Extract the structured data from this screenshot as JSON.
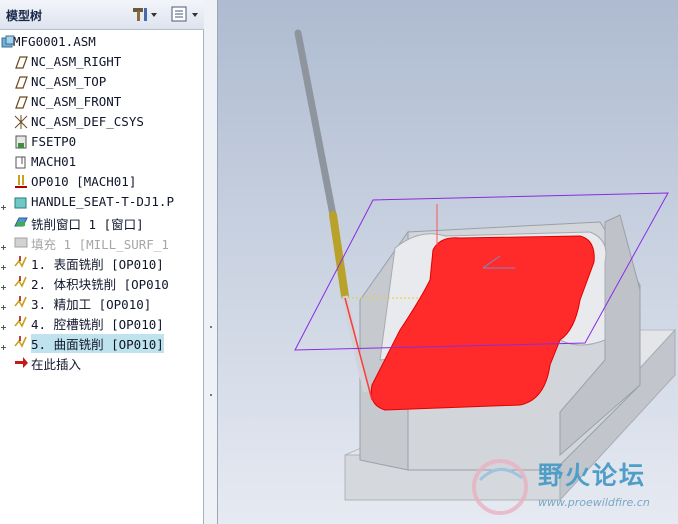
{
  "panel": {
    "title": "模型树",
    "settings_icon": "hammer-settings-icon",
    "show_icon": "list-show-icon"
  },
  "tree": {
    "items": [
      {
        "label": "MFG0001.ASM",
        "icon": "assembly-icon",
        "expander": false,
        "selected": false,
        "dim": false
      },
      {
        "label": "NC_ASM_RIGHT",
        "icon": "datum-plane-icon",
        "expander": false,
        "selected": false,
        "dim": false
      },
      {
        "label": "NC_ASM_TOP",
        "icon": "datum-plane-icon",
        "expander": false,
        "selected": false,
        "dim": false
      },
      {
        "label": "NC_ASM_FRONT",
        "icon": "datum-plane-icon",
        "expander": false,
        "selected": false,
        "dim": false
      },
      {
        "label": "NC_ASM_DEF_CSYS",
        "icon": "csys-icon",
        "expander": false,
        "selected": false,
        "dim": false
      },
      {
        "label": "FSETP0",
        "icon": "fixture-setup-icon",
        "expander": false,
        "selected": false,
        "dim": false
      },
      {
        "label": "MACH01",
        "icon": "machine-icon",
        "expander": false,
        "selected": false,
        "dim": false
      },
      {
        "label": "OP010 [MACH01]",
        "icon": "operation-icon",
        "expander": false,
        "selected": false,
        "dim": false
      },
      {
        "label": "HANDLE_SEAT-T-DJ1.P",
        "icon": "part-icon",
        "expander": true,
        "selected": false,
        "dim": false
      },
      {
        "label": "铣削窗口 1 [窗口]",
        "icon": "mill-window-icon",
        "expander": false,
        "selected": false,
        "dim": false
      },
      {
        "label": "填充 1 [MILL_SURF_1",
        "icon": "fill-icon",
        "expander": true,
        "selected": false,
        "dim": true
      },
      {
        "label": "1. 表面铣削 [OP010]",
        "icon": "toolpath-icon",
        "expander": true,
        "selected": false,
        "dim": false
      },
      {
        "label": "2. 体积块铣削 [OP010",
        "icon": "toolpath-icon",
        "expander": true,
        "selected": false,
        "dim": false
      },
      {
        "label": "3. 精加工 [OP010]",
        "icon": "toolpath-icon",
        "expander": true,
        "selected": false,
        "dim": false
      },
      {
        "label": "4. 腔槽铣削 [OP010]",
        "icon": "toolpath-icon",
        "expander": true,
        "selected": false,
        "dim": false
      },
      {
        "label": "5. 曲面铣削 [OP010]",
        "icon": "toolpath-icon",
        "expander": true,
        "selected": true,
        "dim": false
      },
      {
        "label": "在此插入",
        "icon": "insert-arrow-icon",
        "expander": false,
        "selected": false,
        "dim": false
      }
    ]
  },
  "watermark": {
    "text": "野火论坛",
    "url": "www.proewildfire.cn"
  },
  "colors": {
    "highlight_surface": "#ff2a2a",
    "selection_bg": "#bfe3ee",
    "plane_outline": "#8a2be2",
    "tool_holder": "#b9a22a"
  }
}
